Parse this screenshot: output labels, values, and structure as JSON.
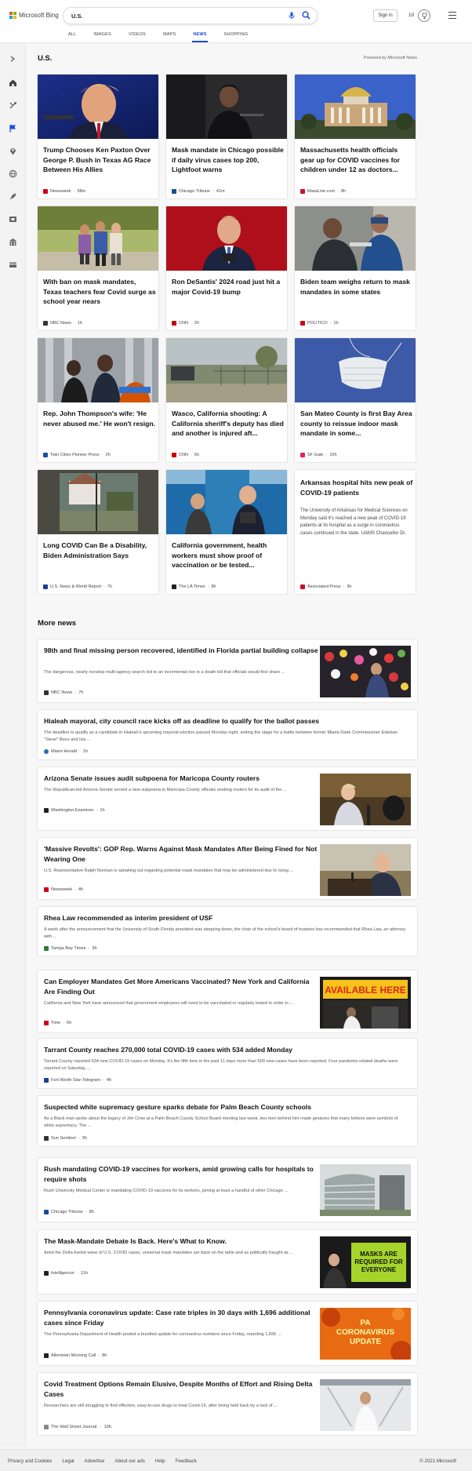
{
  "header": {
    "brand": "Microsoft Bing",
    "search_value": "U.S.",
    "signin_label": "Sign in",
    "points": "10",
    "tabs": [
      {
        "label": "ALL"
      },
      {
        "label": "IMAGES"
      },
      {
        "label": "VIDEOS"
      },
      {
        "label": "MAPS"
      },
      {
        "label": "NEWS",
        "active": true
      },
      {
        "label": "SHOPPING"
      }
    ]
  },
  "rail": {
    "icons": [
      "home-icon",
      "tools-icon",
      "flag-icon",
      "location-icon",
      "globe-icon",
      "rocket-icon",
      "film-icon",
      "building-icon",
      "card-icon"
    ]
  },
  "section": {
    "title": "U.S.",
    "powered_by": "Powered by Microsoft News"
  },
  "cards": [
    {
      "title": "Trump Chooses Ken Paxton Over George P. Bush in Texas AG Race Between His Allies",
      "source": "Newsweek",
      "time": "58m",
      "logo_color": "#d0021b"
    },
    {
      "title": "Mask mandate in Chicago possible if daily virus cases top 200, Lightfoot warns",
      "source": "Chicago Tribune",
      "time": "41m",
      "logo_color": "#1a4d8f"
    },
    {
      "title": "Massachusetts health officials gear up for COVID vaccines for children under 12 as doctors...",
      "source": "MassLive.com",
      "time": "8h",
      "logo_color": "#c8102e"
    },
    {
      "title": "With ban on mask mandates, Texas teachers fear Covid surge as school year nears",
      "source": "NBC News",
      "time": "1h",
      "logo_color": "#333333"
    },
    {
      "title": "Ron DeSantis' 2024 road just hit a major Covid-19 bump",
      "source": "CNN",
      "time": "2h",
      "logo_color": "#cc0000"
    },
    {
      "title": "Biden team weighs return to mask mandates in some states",
      "source": "POLITICO",
      "time": "1h",
      "logo_color": "#d0021b"
    },
    {
      "title": "Rep. John Thompson's wife: 'He never abused me.' He won't resign.",
      "source": "Twin Cities Pioneer Press",
      "time": "2h",
      "logo_color": "#1f4e9e"
    },
    {
      "title": "Wasco, California shooting: A California sheriff's deputy has died and another is injured aft...",
      "source": "CNN",
      "time": "5h",
      "logo_color": "#cc0000"
    },
    {
      "title": "San Mateo County is first Bay Area county to reissue indoor mask mandate in some...",
      "source": "SF Gate",
      "time": "10h",
      "logo_color": "#e0245e"
    },
    {
      "title": "Long COVID Can Be a Disability, Biden Administration Says",
      "source": "U.S. News & World Report",
      "time": "7h",
      "logo_color": "#1f3f8f"
    },
    {
      "title": "California government, health workers must show proof of vaccination or be tested...",
      "source": "The LA Times",
      "time": "8h",
      "logo_color": "#222222"
    },
    {
      "title": "Arkansas hospital hits new peak of COVID-19 patients",
      "snippet": "The University of Arkansas for Medical Sciences on Monday said it's reached a new peak of COVID-19 patients at its hospital as a surge in coronavirus cases continued in the state. UAMS Chancellor Dr.",
      "source": "Associated Press",
      "time": "9h",
      "logo_color": "#c8102e"
    }
  ],
  "more_news": {
    "title": "More news",
    "items": [
      {
        "title": "98th and final missing person recovered, identified in Florida partial building collapse",
        "snippet": "The dangerous, nearly nonstop multi-agency search led to an incremental rise in a death toll that officials would first share ...",
        "source": "NBC News",
        "time": "7h",
        "logo_color": "#333333"
      },
      {
        "title": "Hialeah mayoral, city council race kicks off as deadline to qualify for the ballot passes",
        "snippet": "The deadline to qualify as a candidate in Hialeah's upcoming mayoral election passed Monday night, setting the stage for a battle between former Miami-Dade Commissioner Esteban \"Steve\" Bovo and Isis ...",
        "source": "Miami Herald",
        "time": "1h",
        "logo_color": "#2b6cb0"
      },
      {
        "title": "Arizona Senate issues audit subpoena for Maricopa County routers",
        "snippet": "The Republican-led Arizona Senate served a new subpoena to Maricopa County officials seeking routers for its audit of the ...",
        "source": "Washington Examiner",
        "time": "1h",
        "logo_color": "#222222"
      },
      {
        "title": "'Massive Revolts': GOP Rep. Warns Against Mask Mandates After Being Fined for Not Wearing One",
        "snippet": "U.S. Representative Ralph Norman is speaking out regarding potential mask mandates that may be administered due to rising ...",
        "source": "Newsweek",
        "time": "4h",
        "logo_color": "#d0021b"
      },
      {
        "title": "Rhea Law recommended as interim president of USF",
        "snippet": "A week after the announcement that the University of South Florida president was stepping down, the chair of the school's board of trustees has recommended that Rhea Law, an attorney with ...",
        "source": "Tampa Bay Times",
        "time": "3h",
        "logo_color": "#2e7d32"
      },
      {
        "title": "Can Employer Mandates Get More Americans Vaccinated? New York and California Are Finding Out",
        "snippet": "California and New York have announced that government employees will need to be vaccinated or regularly tested in order to ...",
        "source": "Time",
        "time": "6h",
        "logo_color": "#d0021b"
      },
      {
        "title": "Tarrant County reaches 270,000 total COVID-19 cases with 534 added Monday",
        "snippet": "Tarrant County reported 534 new COVID-19 cases on Monday. It's the fifth time in the past 11 days more than 500 new cases have been reported. Four pandemic-related deaths were reported on Saturday, ...",
        "source": "Fort Worth Star-Telegram",
        "time": "4h",
        "logo_color": "#1f3f8f"
      },
      {
        "title": "Suspected white supremacy gesture sparks debate for Palm Beach County schools",
        "snippet": "As a Black man spoke about the legacy of Jim Crow at a Palm Beach County School Board meeting last week, two men behind him made gestures that many believe were symbols of white supremacy. The ...",
        "source": "Sun Sentinel",
        "time": "3h",
        "logo_color": "#333333"
      },
      {
        "title": "Rush mandating COVID-19 vaccines for workers, amid growing calls for hospitals to require shots",
        "snippet": "Rush University Medical Center is mandating COVID-19 vaccines for its workers, joining at least a handful of other Chicago ...",
        "source": "Chicago Tribune",
        "time": "8h",
        "logo_color": "#1a4d8f"
      },
      {
        "title": "The Mask-Mandate Debate Is Back. Here's What to Know.",
        "snippet": "Amid the Delta-fueled wave of U.S. COVID cases, universal mask mandates are back on the table and as politically fraught as ...",
        "source": "Intelligencer",
        "time": "11h",
        "logo_color": "#222222"
      },
      {
        "title": "Pennsylvania coronavirus update: Case rate triples in 30 days with 1,696 additional cases since Friday",
        "snippet": "The Pennsylvania Department of Health posted a bundled update for coronavirus numbers since Friday, reporting 1,696 ...",
        "source": "Allentown Morning Call",
        "time": "8h",
        "logo_color": "#222222"
      },
      {
        "title": "Covid Treatment Options Remain Elusive, Despite Months of Effort and Rising Delta Cases",
        "snippet": "Researchers are still struggling to find effective, easy-to-use drugs to treat Covid-19, after being held back by a lack of ...",
        "source": "The Wall Street Journal.",
        "time": "10h",
        "logo_color": "#888888"
      }
    ]
  },
  "image_texts": {
    "available_here": "AVAILABLE HERE",
    "masks_required": "MASKS ARE REQUIRED FOR EVERYONE",
    "pa_coronavirus": "PA CORONAVIRUS UPDATE"
  },
  "footer": {
    "links": [
      "Privacy and Cookies",
      "Legal",
      "Advertise",
      "About our ads",
      "Help",
      "Feedback"
    ],
    "copyright": "© 2021 Microsoft"
  }
}
